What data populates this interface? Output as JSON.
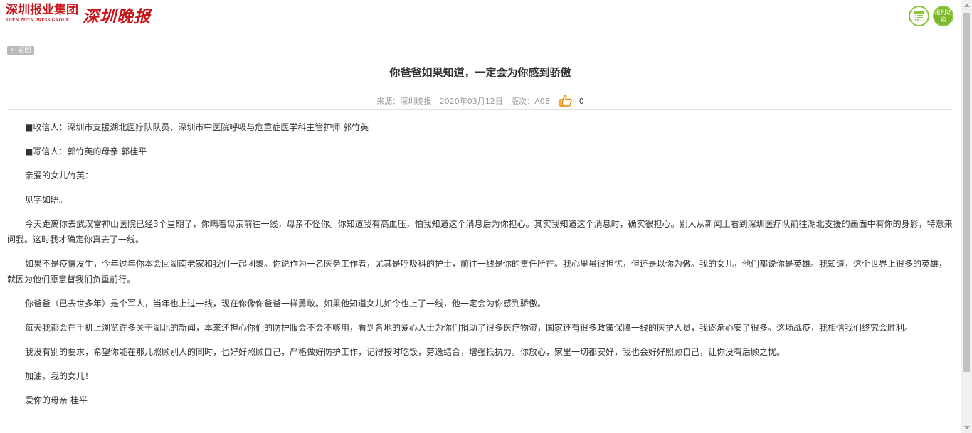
{
  "header": {
    "logo_group_cn": "深圳报业集团",
    "logo_group_en": "SHEN ZHEN PRESS GROUP",
    "logo_paper": "深圳晚报",
    "switch_button": "报刊切换",
    "calendar_icon": "calendar-icon"
  },
  "back_button": "← 返回",
  "article": {
    "title": "你爸爸如果知道，一定会为你感到骄傲",
    "source": "来源：深圳晚报",
    "date": "2020年03月12日",
    "edition": "版次：A08",
    "like_icon": "thumbs-up-icon",
    "likes": "0",
    "paragraphs": [
      "■收信人：深圳市支援湖北医疗队队员、深圳市中医院呼吸与危重症医学科主管护师 郭竹英",
      "■写信人：郭竹英的母亲 郭桂平",
      "亲爱的女儿竹英：",
      "见字如晤。",
      "今天距离你去武汉雷神山医院已经3个星期了，你瞒着母亲前往一线，母亲不怪你。你知道我有高血压，怕我知道这个消息后为你担心。其实我知道这个消息时，确实很担心。别人从新闻上看到深圳医疗队前往湖北支援的画面中有你的身影，特意来问我。这时我才确定你真去了一线。",
      "如果不是疫情发生，今年过年你本会回湖南老家和我们一起团聚。你说作为一名医务工作者，尤其是呼吸科的护士，前往一线是你的责任所在。我心里虽很担忧，但还是以你为傲。我的女儿，他们都说你是英雄。我知道，这个世界上很多的英雄，就因为他们愿意替我们负重前行。",
      "你爸爸（已去世多年）是个军人，当年也上过一线，现在你像你爸爸一样勇敢。如果他知道女儿如今也上了一线，他一定会为你感到骄傲。",
      "每天我都会在手机上浏览许多关于湖北的新闻，本来还担心你们的防护服会不会不够用，看到各地的爱心人士为你们捐助了很多医疗物资，国家还有很多政策保障一线的医护人员，我逐渐心安了很多。这场战疫，我相信我们终究会胜利。",
      "我没有别的要求，希望你能在那儿照顾别人的同时，也好好照顾自己，严格做好防护工作，记得按时吃饭，劳逸结合，增强抵抗力。你放心，家里一切都安好，我也会好好照顾自己，让你没有后顾之忧。",
      "加油，我的女儿！",
      "爱你的母亲 桂平"
    ]
  },
  "colors": {
    "brand_red": "#c8161d",
    "accent_green": "#7ab52a",
    "like_orange": "#f08200"
  }
}
